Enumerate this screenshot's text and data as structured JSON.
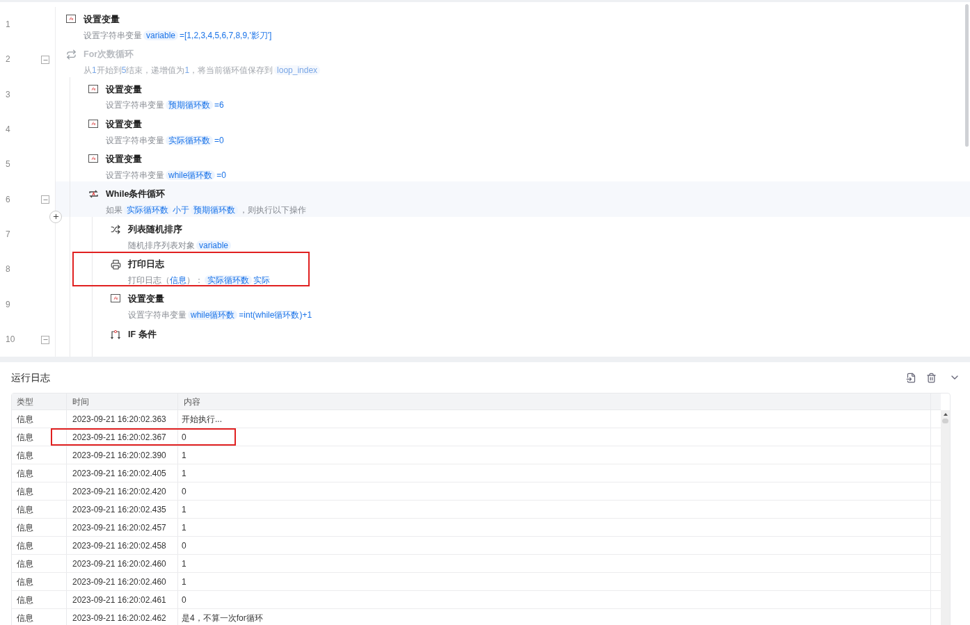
{
  "flow": {
    "steps": [
      {
        "line": "1",
        "kind": "set",
        "title": "设置变量",
        "collapsible": false,
        "disabled": false,
        "hovered": false,
        "marked": false,
        "desc": [
          {
            "kind": "plain",
            "text": "设置字符串变量"
          },
          {
            "kind": "token",
            "text": "variable"
          },
          {
            "kind": "value",
            "text": "=[1,2,3,4,5,6,7,8,9,'影刀']"
          }
        ]
      },
      {
        "line": "2",
        "kind": "for",
        "title": "For次数循环",
        "collapsible": true,
        "disabled": true,
        "hovered": false,
        "marked": false,
        "desc": [
          {
            "kind": "plain",
            "text": "从"
          },
          {
            "kind": "value",
            "text": "1"
          },
          {
            "kind": "plain",
            "text": "开始到"
          },
          {
            "kind": "value",
            "text": "5"
          },
          {
            "kind": "plain",
            "text": "结束，递增值为"
          },
          {
            "kind": "value",
            "text": "1"
          },
          {
            "kind": "plain",
            "text": "，将当前循环值保存到"
          },
          {
            "kind": "token",
            "text": "loop_index"
          }
        ],
        "children": [
          {
            "line": "3",
            "kind": "set",
            "title": "设置变量",
            "collapsible": false,
            "disabled": false,
            "hovered": false,
            "marked": false,
            "desc": [
              {
                "kind": "plain",
                "text": "设置字符串变量"
              },
              {
                "kind": "token",
                "text": "预期循环数"
              },
              {
                "kind": "value",
                "text": "=6"
              }
            ]
          },
          {
            "line": "4",
            "kind": "set",
            "title": "设置变量",
            "collapsible": false,
            "disabled": false,
            "hovered": false,
            "marked": false,
            "desc": [
              {
                "kind": "plain",
                "text": "设置字符串变量"
              },
              {
                "kind": "token",
                "text": "实际循环数"
              },
              {
                "kind": "value",
                "text": "=0"
              }
            ]
          },
          {
            "line": "5",
            "kind": "set",
            "title": "设置变量",
            "collapsible": false,
            "disabled": false,
            "hovered": false,
            "marked": false,
            "desc": [
              {
                "kind": "plain",
                "text": "设置字符串变量"
              },
              {
                "kind": "token",
                "text": "while循环数"
              },
              {
                "kind": "value",
                "text": "=0"
              }
            ]
          },
          {
            "line": "6",
            "kind": "while",
            "title": "While条件循环",
            "collapsible": true,
            "disabled": false,
            "hovered": true,
            "marked": false,
            "desc": [
              {
                "kind": "plain",
                "text": "如果"
              },
              {
                "kind": "token",
                "text": "实际循环数"
              },
              {
                "kind": "value",
                "text": "小于"
              },
              {
                "kind": "token",
                "text": "预期循环数"
              },
              {
                "kind": "plain",
                "text": "，则执行以下操作"
              }
            ],
            "children": [
              {
                "line": "7",
                "kind": "shuffle",
                "title": "列表随机排序",
                "collapsible": false,
                "disabled": false,
                "hovered": false,
                "marked": false,
                "desc": [
                  {
                    "kind": "plain",
                    "text": "随机排序列表对象"
                  },
                  {
                    "kind": "token",
                    "text": "variable"
                  }
                ]
              },
              {
                "line": "8",
                "kind": "print",
                "title": "打印日志",
                "collapsible": false,
                "disabled": false,
                "hovered": false,
                "marked": true,
                "desc": [
                  {
                    "kind": "plain",
                    "text": "打印日志（"
                  },
                  {
                    "kind": "value",
                    "text": "信息"
                  },
                  {
                    "kind": "plain",
                    "text": "）："
                  },
                  {
                    "kind": "token",
                    "text": "实际循环数"
                  },
                  {
                    "kind": "value",
                    "text": "实际"
                  }
                ]
              },
              {
                "line": "9",
                "kind": "set",
                "title": "设置变量",
                "collapsible": false,
                "disabled": false,
                "hovered": false,
                "marked": false,
                "desc": [
                  {
                    "kind": "plain",
                    "text": "设置字符串变量"
                  },
                  {
                    "kind": "token",
                    "text": "while循环数"
                  },
                  {
                    "kind": "value",
                    "text": "=int(while循环数)+1"
                  }
                ]
              },
              {
                "line": "10",
                "kind": "if",
                "title": "IF 条件",
                "collapsible": true,
                "disabled": false,
                "hovered": false,
                "marked": false
              }
            ]
          }
        ]
      }
    ]
  },
  "log": {
    "title": "运行日志",
    "columns": [
      "类型",
      "时间",
      "内容"
    ],
    "rows": [
      {
        "type": "信息",
        "time": "2023-09-21 16:20:02.363",
        "content": "开始执行...",
        "marked": false
      },
      {
        "type": "信息",
        "time": "2023-09-21 16:20:02.367",
        "content": "0",
        "marked": true
      },
      {
        "type": "信息",
        "time": "2023-09-21 16:20:02.390",
        "content": "1",
        "marked": false
      },
      {
        "type": "信息",
        "time": "2023-09-21 16:20:02.405",
        "content": "1",
        "marked": false
      },
      {
        "type": "信息",
        "time": "2023-09-21 16:20:02.420",
        "content": "0",
        "marked": false
      },
      {
        "type": "信息",
        "time": "2023-09-21 16:20:02.435",
        "content": "1",
        "marked": false
      },
      {
        "type": "信息",
        "time": "2023-09-21 16:20:02.457",
        "content": "1",
        "marked": false
      },
      {
        "type": "信息",
        "time": "2023-09-21 16:20:02.458",
        "content": "0",
        "marked": false
      },
      {
        "type": "信息",
        "time": "2023-09-21 16:20:02.460",
        "content": "1",
        "marked": false
      },
      {
        "type": "信息",
        "time": "2023-09-21 16:20:02.460",
        "content": "1",
        "marked": false
      },
      {
        "type": "信息",
        "time": "2023-09-21 16:20:02.461",
        "content": "0",
        "marked": false
      },
      {
        "type": "信息",
        "time": "2023-09-21 16:20:02.462",
        "content": "是4，不算一次for循环",
        "marked": false
      }
    ]
  }
}
